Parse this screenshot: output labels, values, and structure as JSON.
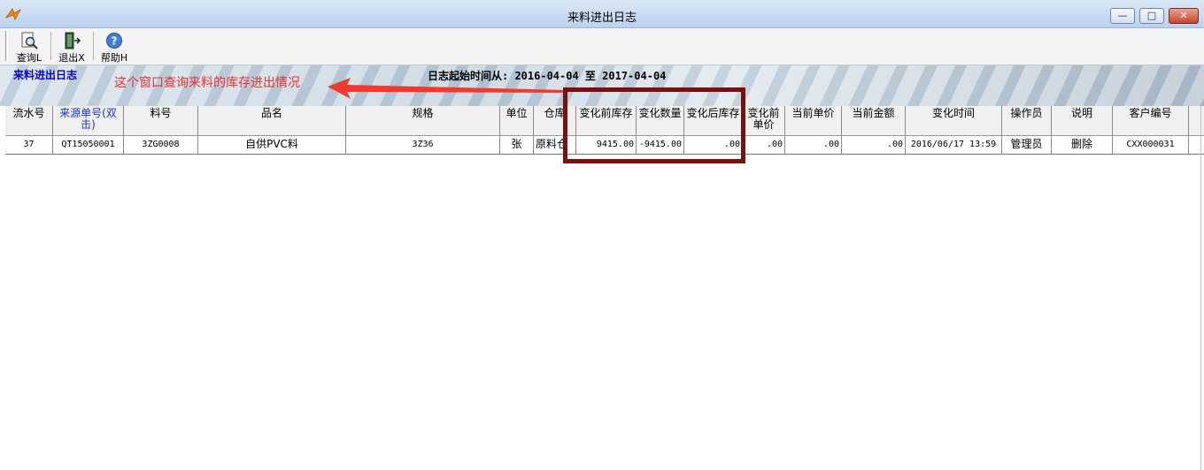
{
  "window": {
    "title": "来料进出日志",
    "controls": {
      "minimize": "—",
      "maximize": "□",
      "close": "✕"
    }
  },
  "toolbar": {
    "query_label": "查询L",
    "exit_label": "退出X",
    "help_label": "帮助H"
  },
  "banner": {
    "title": "来料进出日志",
    "annotation": "这个窗口查询来料的库存进出情况",
    "log_range": "日志起始时间从:  2016-04-04  至  2017-04-04"
  },
  "table": {
    "headers": {
      "serial": "流水号",
      "source_no": "来源单号(双击)",
      "material_no": "料号",
      "product_name": "品名",
      "spec": "规格",
      "unit": "单位",
      "warehouse": "仓库",
      "stock_before": "变化前库存",
      "change_qty": "变化数量",
      "stock_after": "变化后库存",
      "price_before": "变化前单价",
      "current_price": "当前单价",
      "current_amount": "当前金额",
      "change_time": "变化时间",
      "operator": "操作员",
      "note": "说明",
      "customer_no": "客户编号"
    },
    "rows": [
      {
        "serial": "37",
        "source_no": "QT15050001",
        "material_no": "3ZG0008",
        "product_name": "自供PVC料",
        "spec": "3Z36",
        "unit": "张",
        "warehouse": "原料仓",
        "stock_before": "9415.00",
        "change_qty": "-9415.00",
        "stock_after": ".00",
        "price_before": ".00",
        "current_price": ".00",
        "current_amount": ".00",
        "change_time": "2016/06/17 13:59",
        "operator": "管理员",
        "note": "删除",
        "customer_no": "CXX000031"
      }
    ]
  },
  "colors": {
    "annotation": "#e8322d",
    "highlight_box": "#7a0f0f",
    "banner_title": "#0000c8"
  }
}
